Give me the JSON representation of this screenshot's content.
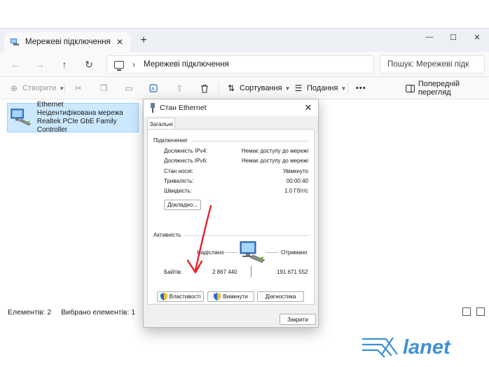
{
  "window": {
    "tab_title": "Мережеві підключення",
    "tab_close": "✕",
    "new_tab": "+",
    "controls": [
      "—",
      "☐",
      "✕"
    ]
  },
  "address": {
    "breadcrumb": "Мережеві підключення",
    "search_placeholder": "Пошук: Мережеві підк"
  },
  "toolbar": {
    "create_label": "Створити",
    "sort_label": "Сортування",
    "view_label": "Подання",
    "more_label": "•••",
    "preview_label": "Попередній перегляд"
  },
  "item": {
    "name": "Ethernet",
    "status": "Неідентифікована мережа",
    "adapter": "Realtek PCIe GbE Family Controller"
  },
  "statusbar": {
    "count": "Елементів: 2",
    "selected": "Вибрано елементів: 1"
  },
  "dialog": {
    "title": "Стан Ethernet",
    "close": "✕",
    "tab_general": "Загальні",
    "connection": {
      "title": "Підключення",
      "rows": [
        {
          "label": "Досяжність IPv4:",
          "value": "Немає доступу до мережі"
        },
        {
          "label": "Досяжність IPv6:",
          "value": "Немає доступу до мережі"
        },
        {
          "label": "Стан носія:",
          "value": "Увімкнуто"
        },
        {
          "label": "Тривалість:",
          "value": "00:00:40"
        },
        {
          "label": "Швидкість:",
          "value": "1.0 Гбіт/с"
        }
      ],
      "details_button": "Докладно..."
    },
    "activity": {
      "title": "Активність",
      "sent_label": "Надіслано",
      "received_label": "Отримано",
      "bytes_label": "Байтів:",
      "bytes_sent": "2 867 440",
      "bytes_received": "191 671 552"
    },
    "buttons": {
      "properties": "Властивості",
      "disable": "Вимкнути",
      "diagnose": "Діагностика",
      "close": "Закрити"
    }
  },
  "annotation": {
    "arrow_color": "#e3202b"
  },
  "branding": {
    "logo_text": "lanet",
    "logo_color": "#3f8fd6"
  }
}
